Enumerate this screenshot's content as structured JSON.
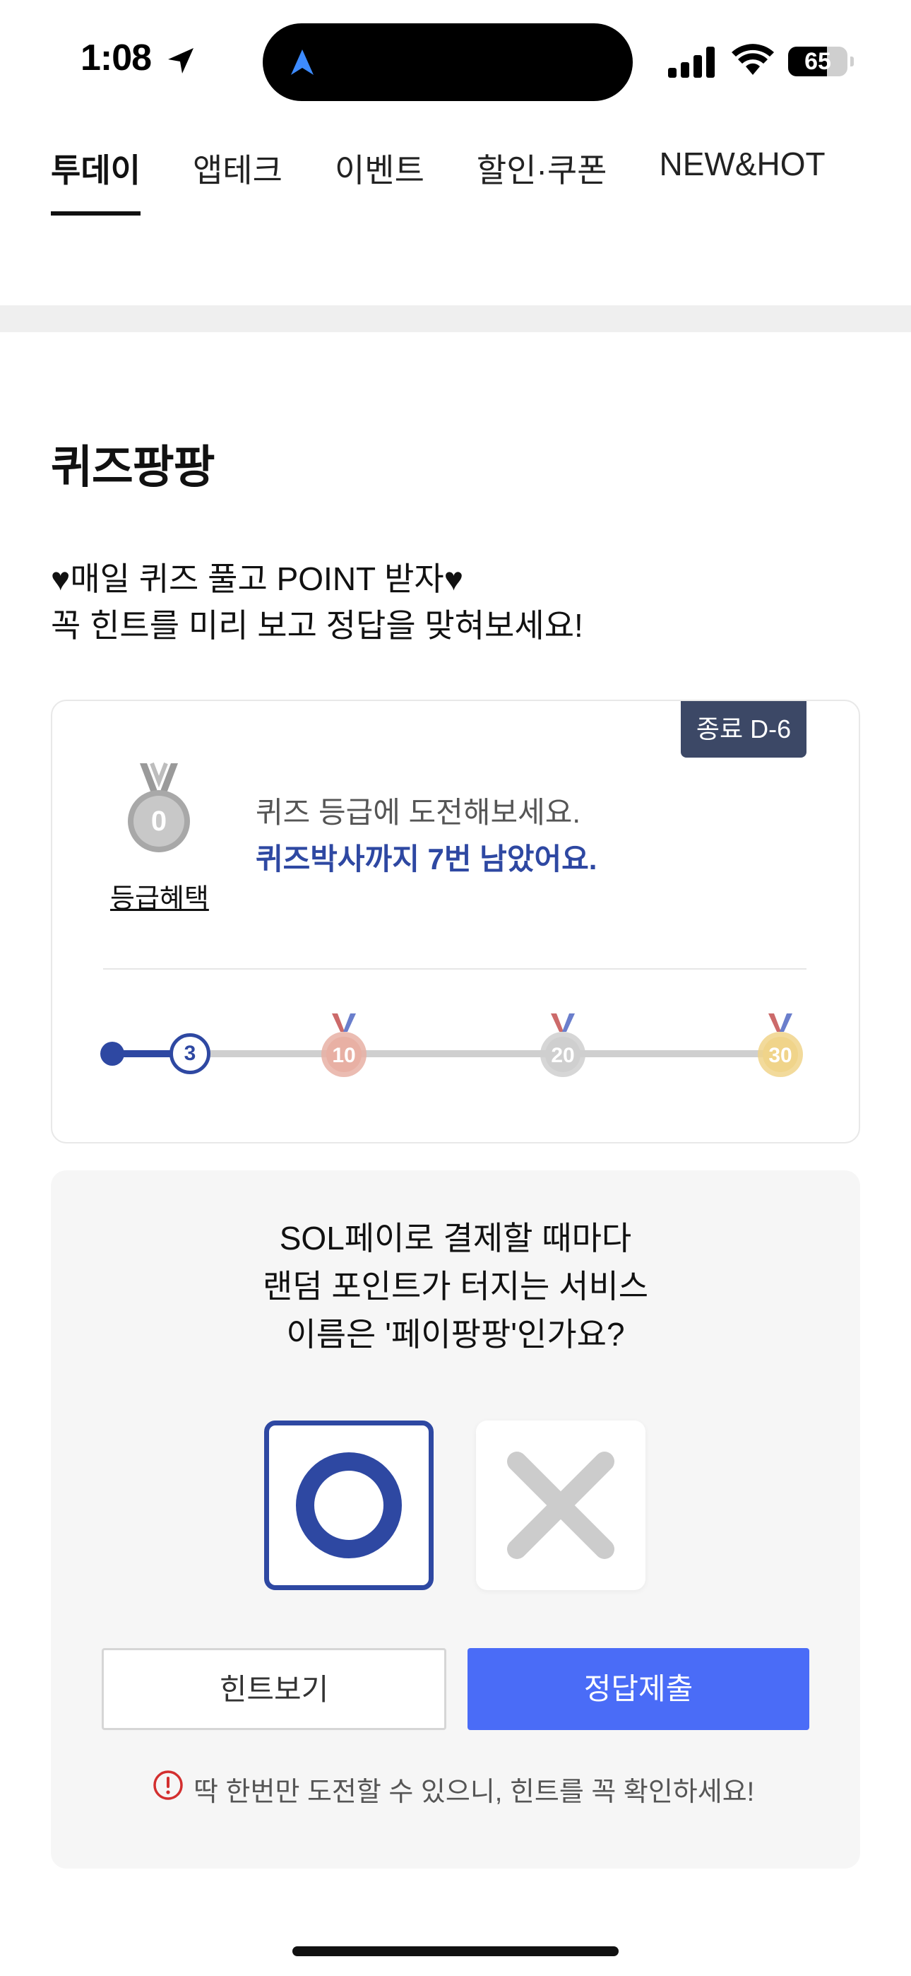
{
  "status_bar": {
    "time": "1:08",
    "battery": "65",
    "battery_level": 0.65
  },
  "tabs": [
    {
      "label": "투데이",
      "active": true
    },
    {
      "label": "앱테크",
      "active": false
    },
    {
      "label": "이벤트",
      "active": false
    },
    {
      "label": "할인·쿠폰",
      "active": false
    },
    {
      "label": "NEW&HOT",
      "active": false
    }
  ],
  "section": {
    "title": "퀴즈팡팡",
    "subtitle_line1": "♥매일 퀴즈 풀고 POINT 받자♥",
    "subtitle_line2": "꼭 힌트를 미리 보고 정답을 맞혀보세요!"
  },
  "grade_card": {
    "dday": "종료 D-6",
    "medal_value": "0",
    "benefit_link": "등급혜택",
    "line1": "퀴즈 등급에 도전해보세요.",
    "line2": "퀴즈박사까지 7번 남았어요.",
    "progress": {
      "current": "3",
      "milestones": [
        "10",
        "20",
        "30"
      ],
      "milestone_colors": [
        "#e8b0a4",
        "#cfcfcf",
        "#f0d48a"
      ]
    }
  },
  "quiz": {
    "question_lines": [
      "SOL페이로 결제할 때마다",
      "랜덤 포인트가 터지는 서비스",
      "이름은 '페이팡팡'인가요?"
    ],
    "selected": "O",
    "hint_button": "힌트보기",
    "submit_button": "정답제출",
    "warning": "딱 한번만 도전할 수 있으니, 힌트를 꼭 확인하세요!"
  },
  "colors": {
    "accent": "#2e48a2",
    "submit": "#4a6cf7",
    "dday_bg": "#3c4866",
    "warning_icon": "#d32f2f"
  }
}
